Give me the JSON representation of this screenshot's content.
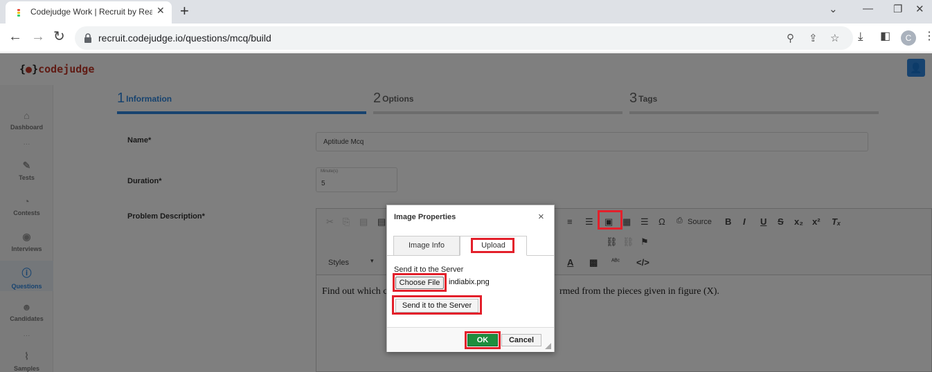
{
  "browser": {
    "tab_title": "Codejudge Work | Recruit by Rea",
    "tab_close": "✕",
    "new_tab": "+",
    "url": "recruit.codejudge.io/questions/mcq/build",
    "profile_initial": "C"
  },
  "app": {
    "logo_brace_open": "{",
    "logo_brace_close": "}",
    "logo_text": "codejudge",
    "sidebar": [
      {
        "label": "Dashboard",
        "icon": "home-icon"
      },
      {
        "label": "Tests",
        "icon": "pen-icon"
      },
      {
        "label": "Contests",
        "icon": "pie-icon"
      },
      {
        "label": "Interviews",
        "icon": "bulb-icon"
      },
      {
        "label": "Questions",
        "icon": "question-icon",
        "active": true
      },
      {
        "label": "Candidates",
        "icon": "users-icon"
      },
      {
        "label": "Samples",
        "icon": "chart-icon"
      }
    ],
    "steps": [
      {
        "num": "1",
        "label": "Information",
        "active": true
      },
      {
        "num": "2",
        "label": "Options"
      },
      {
        "num": "3",
        "label": "Tags"
      }
    ],
    "form": {
      "name_label": "Name*",
      "name_value": "Aptitude Mcq",
      "duration_label": "Duration*",
      "duration_caption": "Minute(s)",
      "duration_value": "5",
      "desc_label": "Problem Description*"
    },
    "editor": {
      "source_label": "Source",
      "styles_label": "Styles",
      "text_left": "Find out which c",
      "text_right": "rmed from the pieces given in figure (X)."
    }
  },
  "dialog": {
    "title": "Image Properties",
    "close": "×",
    "tabs": [
      "Image Info",
      "Upload"
    ],
    "send_label": "Send it to the Server",
    "choose_file": "Choose File",
    "file_name": "indiabix.png",
    "send_button": "Send it to the Server",
    "ok": "OK",
    "cancel": "Cancel"
  },
  "colors": {
    "accent": "#2e86de",
    "highlight": "#e3202b",
    "ok_green": "#1e8e3e"
  }
}
